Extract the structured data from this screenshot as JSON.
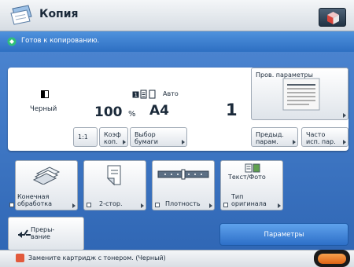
{
  "app": {
    "title": "Копия",
    "icon": "copy-icon"
  },
  "top_button": {
    "icon": "home-cube-icon"
  },
  "status": {
    "message": "Готов к копированию.",
    "icon": "ready-icon"
  },
  "settings": {
    "color_mode": "Черный",
    "zoom": "100",
    "zoom_unit": "%",
    "paper_mode": "Авто",
    "paper_size": "A4",
    "copies": "1"
  },
  "buttons": {
    "ratio": "1:1",
    "zoom_factor": [
      "Коэф",
      "коп."
    ],
    "paper_select": [
      "Выбор",
      "бумаги"
    ],
    "check_params": "Пров. параметры",
    "prev_settings": [
      "Предыд.",
      "парам."
    ],
    "favorites": [
      "Часто",
      "исп. пар."
    ]
  },
  "functions": [
    {
      "name": "finishing",
      "lines": [
        "Конечная",
        "обработка"
      ],
      "icon": "finishing-icon"
    },
    {
      "name": "duplex",
      "lines": [
        "2-стор."
      ],
      "icon": "duplex-icon"
    },
    {
      "name": "density",
      "lines": [
        "Плотность"
      ],
      "icon": "density-slider-icon"
    },
    {
      "name": "original-type",
      "lines": [
        "Тип",
        "оригинала"
      ],
      "caption": "Текст/Фото",
      "icon": "text-photo-icon"
    }
  ],
  "interrupt": {
    "lines": [
      "Преры-",
      "вание"
    ],
    "icon": "interrupt-arrow-icon"
  },
  "params_label": "Параметры",
  "warning": {
    "text": "Замените картридж с тонером. (Черный)",
    "icon": "warning-icon"
  },
  "status_monitor": {
    "icon": "status-monitor-icon"
  },
  "colors": {
    "accent_blue": "#2f66b4",
    "status_blue": "#2e6fc2",
    "warning_red": "#e25a3c",
    "monitor_orange": "#e06516"
  }
}
